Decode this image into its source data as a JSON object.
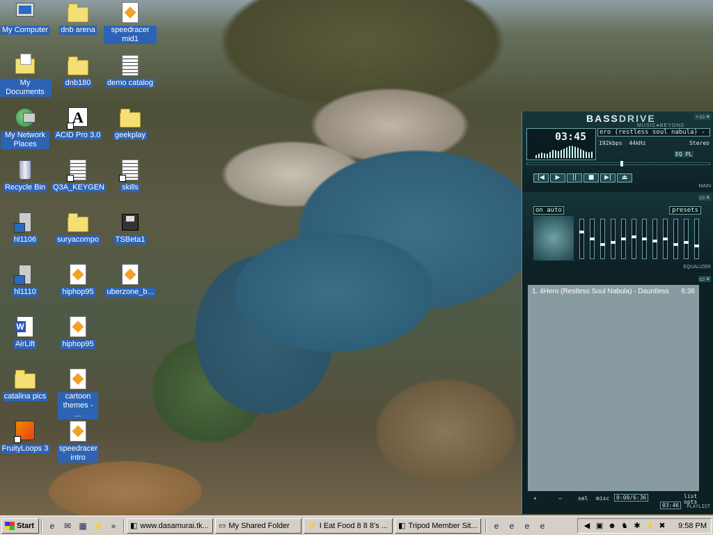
{
  "desktop": {
    "icons": [
      {
        "label": "My Computer",
        "icon": "my-computer-icon"
      },
      {
        "label": "dnb arena",
        "icon": "folder-icon"
      },
      {
        "label": "speedracer mid1",
        "icon": "audio-file-icon"
      },
      {
        "label": "My Documents",
        "icon": "my-documents-icon"
      },
      {
        "label": "dnb180",
        "icon": "folder-icon"
      },
      {
        "label": "demo catalog",
        "icon": "text-document-icon"
      },
      {
        "label": "My Network Places",
        "icon": "network-places-icon"
      },
      {
        "label": "ACID Pro 3.0",
        "icon": "acid-pro-icon"
      },
      {
        "label": "geekplay",
        "icon": "folder-icon"
      },
      {
        "label": "Recycle Bin",
        "icon": "recycle-bin-icon"
      },
      {
        "label": "Q3A_KEYGEN",
        "icon": "program-icon"
      },
      {
        "label": "skills",
        "icon": "program-icon"
      },
      {
        "label": "hl1106",
        "icon": "server-icon"
      },
      {
        "label": "suryacompo",
        "icon": "folder-icon"
      },
      {
        "label": "TSBeta1",
        "icon": "floppy-icon"
      },
      {
        "label": "hl1110",
        "icon": "server-icon"
      },
      {
        "label": "hiphop95",
        "icon": "audio-file-icon"
      },
      {
        "label": "uberzone_b...",
        "icon": "audio-file-icon"
      },
      {
        "label": "AirLift",
        "icon": "word-document-icon"
      },
      {
        "label": "hiphop95",
        "icon": "audio-file-icon"
      },
      {
        "label": "catalina pics",
        "icon": "folder-icon"
      },
      {
        "label": "cartoon themes - ...",
        "icon": "audio-file-icon"
      },
      {
        "label": "FruityLoops 3",
        "icon": "fruityloops-icon"
      },
      {
        "label": "speedracer intro",
        "icon": "audio-file-icon"
      }
    ]
  },
  "winamp": {
    "logo_left": "BASS",
    "logo_right": "DRIVE",
    "tagline": "MUSIC●BEYOND",
    "time": "03:45",
    "ticker": "ero (restless soul nabula) - da",
    "kbps": "192kbps",
    "khz": "44kHz",
    "channels": "Stereo",
    "transport": [
      "|◀",
      "▶",
      "||",
      "■",
      "▶|",
      "⏏"
    ],
    "main_label": "MAIN",
    "eq_on": "on",
    "eq_auto": "auto",
    "presets": "presets",
    "eq_label": "EQUALIZER",
    "eq_levels": [
      0.7,
      0.5,
      0.35,
      0.4,
      0.5,
      0.55,
      0.5,
      0.45,
      0.5,
      0.35,
      0.4,
      0.3
    ],
    "playlist": [
      {
        "title": "1. 4Hero (Restless Soul Nabula) - Dauntless",
        "duration": "6:36"
      }
    ],
    "pl_buttons": [
      "+",
      "–",
      "sel",
      "misc"
    ],
    "pl_time": "0:00/6:36",
    "pl_small": "03:46",
    "pl_list": "list opts",
    "pl_label": "PLAYLIST"
  },
  "taskbar": {
    "start": "Start",
    "quicklaunch": [
      "ie-icon",
      "outlook-icon",
      "desktop-icon",
      "winamp-icon"
    ],
    "more": "»",
    "windows": [
      {
        "label": "www.dasamurai.tk..."
      },
      {
        "label": "My Shared Folder"
      },
      {
        "label": "I Eat Food 8 8 8's ..."
      },
      {
        "label": "Tripod Member Sit..."
      }
    ],
    "clock": "9:58 PM"
  }
}
